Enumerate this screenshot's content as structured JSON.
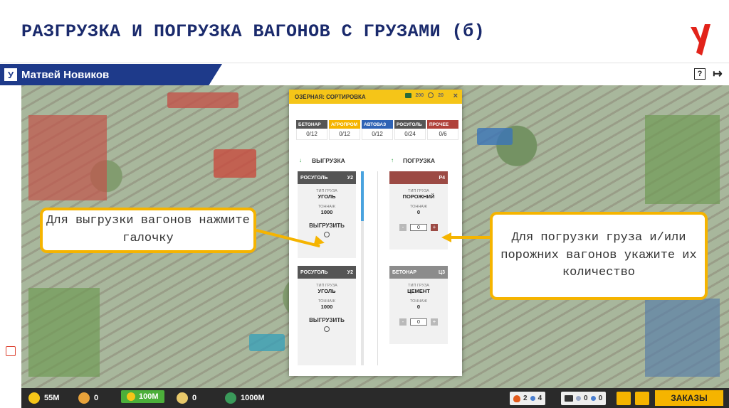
{
  "slide": {
    "title": "РАЗГРУЗКА И ПОГРУЗКА ВАГОНОВ С ГРУЗАМИ (б)"
  },
  "userbar": {
    "logo_letter": "У",
    "user_name": "Матвей Новиков",
    "help_icon_glyph": "?",
    "logout_icon_glyph": "↦"
  },
  "dialog": {
    "title": "ОЗЁРНАЯ: СОРТИРОВКА",
    "meta_a": "200",
    "meta_b": "20",
    "close_glyph": "×",
    "categories": [
      {
        "name": "БЕТОНАР",
        "count": "0/12",
        "color": "#555555"
      },
      {
        "name": "АГРОПРОМ",
        "count": "0/12",
        "color": "#f5b400"
      },
      {
        "name": "АВТОВАЗ",
        "count": "0/12",
        "color": "#2f63b5"
      },
      {
        "name": "РОСУГОЛЬ",
        "count": "0/24",
        "color": "#555555"
      },
      {
        "name": "ПРОЧЕЕ",
        "count": "0/6",
        "color": "#b0413a"
      }
    ],
    "unload": {
      "title": "ВЫГРУЗКА",
      "arrow": "↓",
      "cards": [
        {
          "owner": "РОСУГОЛЬ",
          "code": "У2",
          "type_label": "ТИП ГРУЗА",
          "type": "УГОЛЬ",
          "tonnage_label": "ТОННАЖ",
          "tonnage": "1000",
          "action": "ВЫГРУЗИТЬ"
        },
        {
          "owner": "РОСУГОЛЬ",
          "code": "У2",
          "type_label": "ТИП ГРУЗА",
          "type": "УГОЛЬ",
          "tonnage_label": "ТОННАЖ",
          "tonnage": "1000",
          "action": "ВЫГРУЗИТЬ"
        }
      ]
    },
    "load": {
      "title": "ПОГРУЗКА",
      "arrow": "↑",
      "cards": [
        {
          "owner": "",
          "code": "Р4",
          "type_label": "ТИП ГРУЗА",
          "type": "ПОРОЖНИЙ",
          "tonnage_label": "ТОННАЖ",
          "tonnage": "0",
          "qty": "0",
          "minus": "-",
          "plus": "+"
        },
        {
          "owner": "БЕТОНАР",
          "code": "Ц3",
          "type_label": "ТИП ГРУЗА",
          "type": "ЦЕМЕНТ",
          "tonnage_label": "ТОННАЖ",
          "tonnage": "0",
          "qty": "0",
          "minus": "-",
          "plus": "+"
        }
      ]
    }
  },
  "callouts": {
    "unload": "Для выгрузки вагонов нажмите галочку",
    "load": "Для погрузки груза и/или порожних вагонов укажите их количество"
  },
  "bottombar": {
    "money": "55М",
    "stat2": "0",
    "stat3": "100М",
    "stat4": "0",
    "stat5": "1000М",
    "right_a": "2",
    "right_b": "4",
    "right_c": "0",
    "right_d": "0",
    "orders_label": "ЗАКАЗЫ"
  }
}
